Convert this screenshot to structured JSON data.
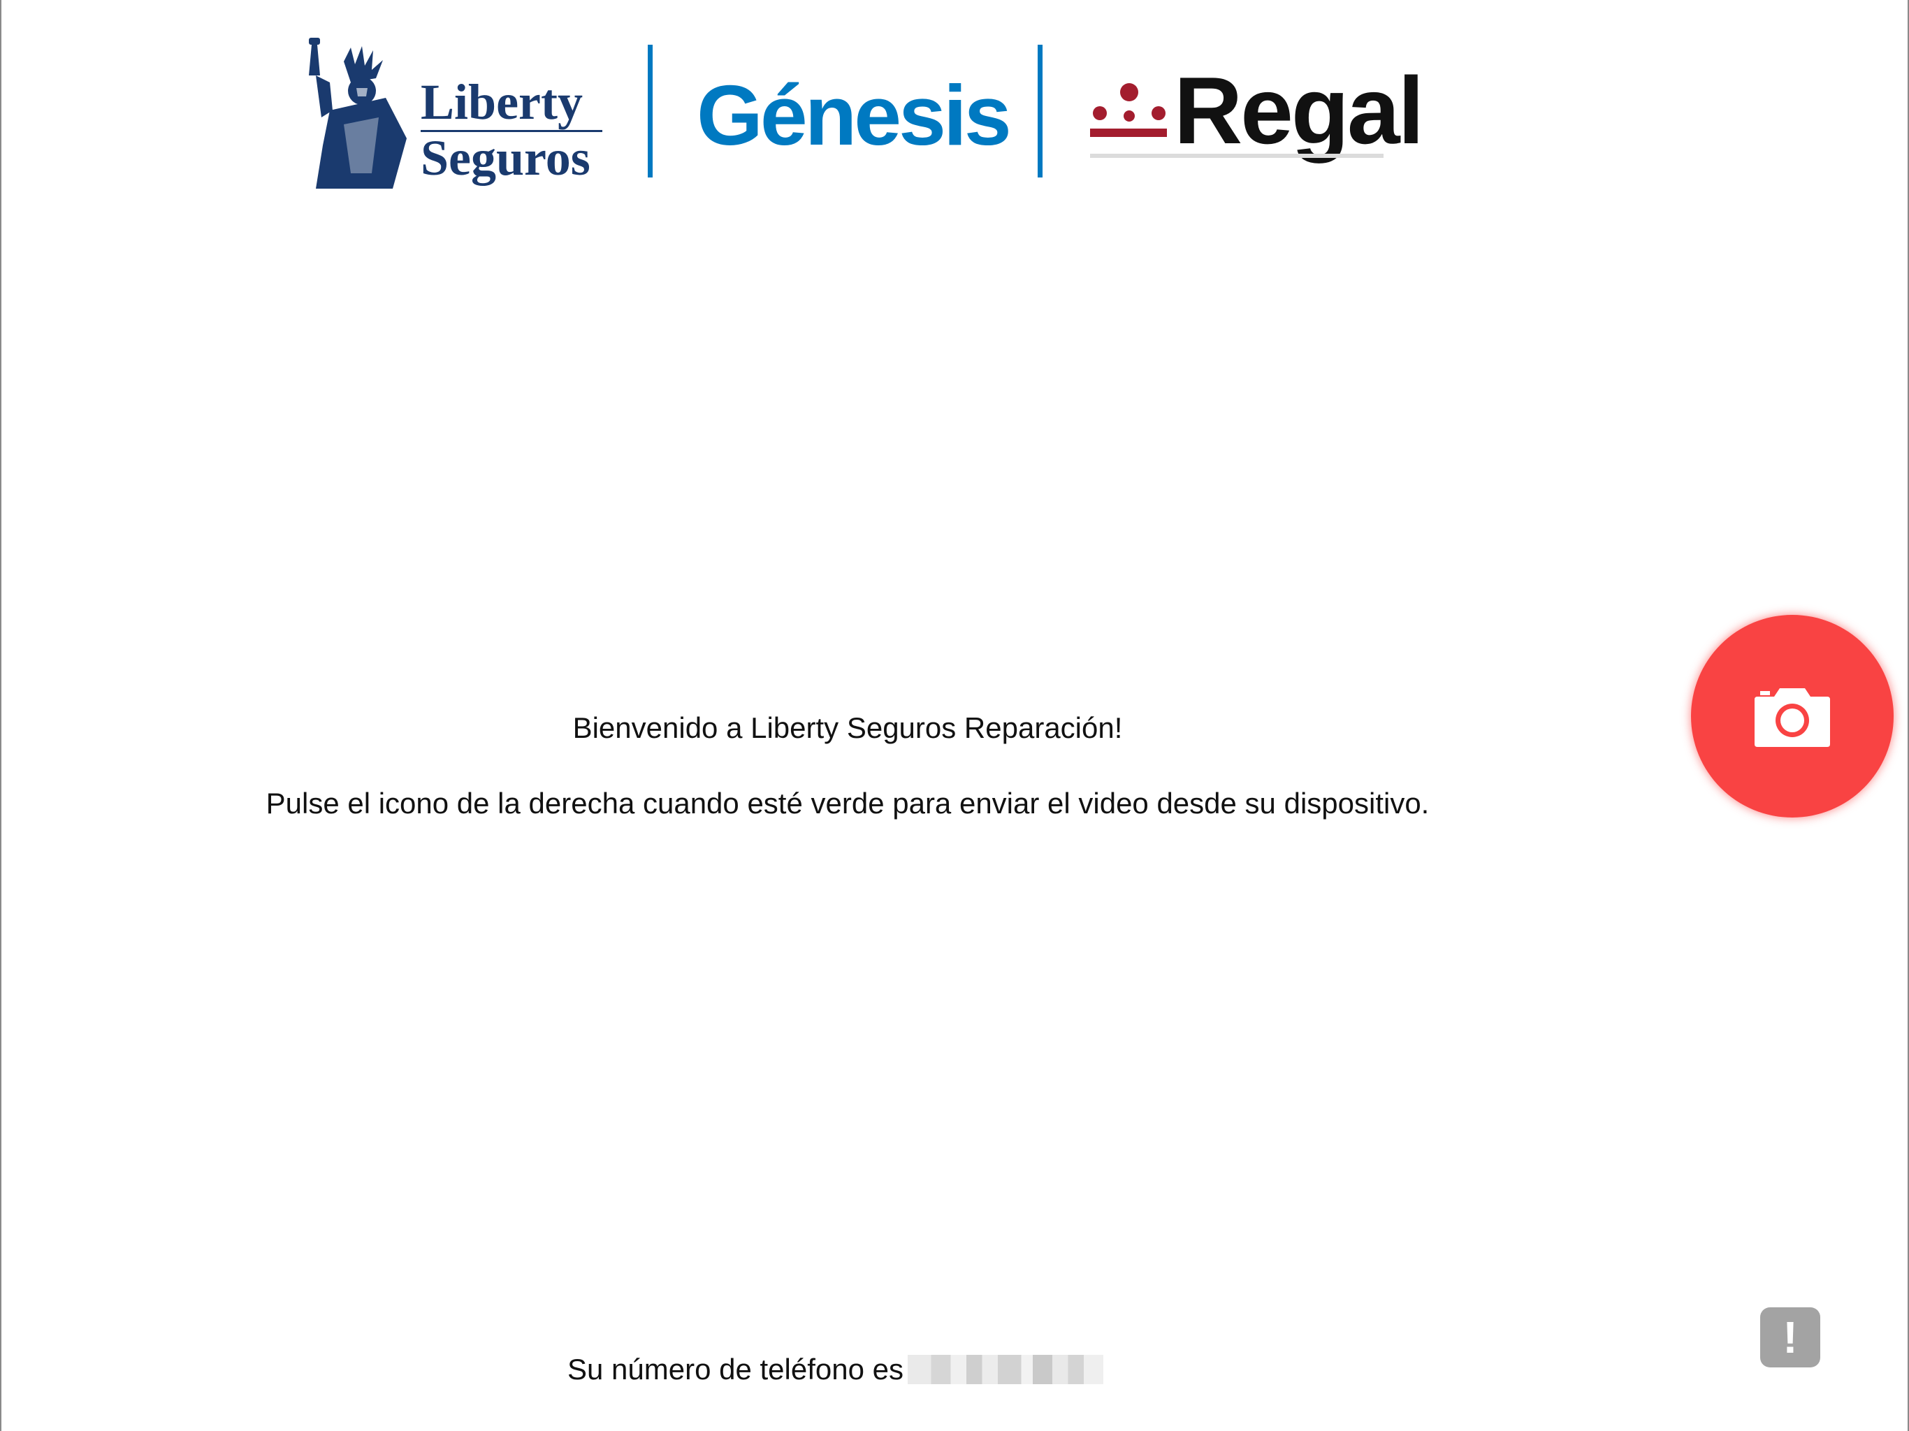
{
  "brands": {
    "liberty": {
      "line1": "Liberty",
      "line2": "Seguros"
    },
    "genesis": "Génesis",
    "regal": "Regal",
    "colors": {
      "liberty_navy": "#1a3a6e",
      "genesis_blue": "#0079c1",
      "regal_red": "#a31d2e"
    }
  },
  "messages": {
    "welcome": "Bienvenido a Liberty Seguros Reparación!",
    "instructions": "Pulse el icono de la derecha cuando esté verde para enviar el video desde su dispositivo."
  },
  "phone": {
    "label": "Su número de teléfono es",
    "value": "redacted-number"
  },
  "buttons": {
    "camera": {
      "icon": "camera-icon",
      "color": "#f94343"
    },
    "alert": {
      "icon": "exclamation-icon",
      "label": "!",
      "color": "#a3a3a3"
    }
  }
}
